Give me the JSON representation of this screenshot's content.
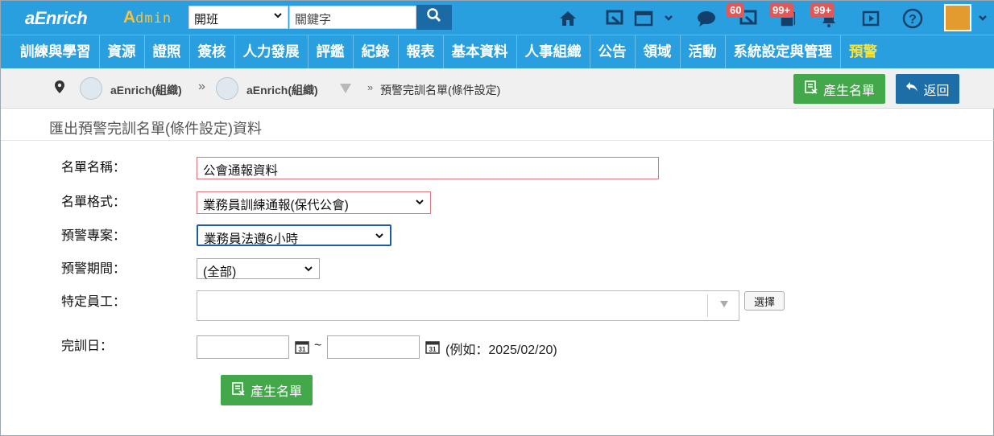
{
  "app": {
    "logo": "aEnrich",
    "admin_label_a": "A",
    "admin_label_rest": "dmin"
  },
  "topbar": {
    "course_select": "開班",
    "keyword_placeholder": "關鍵字",
    "badges": [
      "60",
      "99+",
      "99+"
    ]
  },
  "menu": {
    "items": [
      "訓練與學習",
      "資源",
      "證照",
      "簽核",
      "人力發展",
      "評鑑",
      "紀錄",
      "報表",
      "基本資料",
      "人事組織",
      "公告",
      "領域",
      "活動",
      "系統設定與管理",
      "預警"
    ],
    "active": "預警"
  },
  "breadcrumb": {
    "org1": "aEnrich(組織)",
    "org2": "aEnrich(組織)",
    "current": "預警完訓名單(條件設定)"
  },
  "actions": {
    "generate": "產生名單",
    "back": "返回"
  },
  "page": {
    "title": "匯出預警完訓名單(條件設定)資料"
  },
  "form": {
    "list_name_label": "名單名稱：",
    "list_name_value": "公會通報資料",
    "format_label": "名單格式：",
    "format_value": "業務員訓練通報(保代公會)",
    "project_label": "預警專案：",
    "project_value": "業務員法遵6小時",
    "period_label": "預警期間：",
    "period_value": "(全部)",
    "employee_label": "特定員工：",
    "choose_label": "選擇",
    "date_label": "完訓日：",
    "date_sep": "~",
    "date_hint": "(例如：2025/02/20)",
    "submit_label": "產生名單"
  },
  "colors": {
    "topbar": "#2a9fe0",
    "active_menu": "#f5e23a",
    "green": "#43a84a",
    "blue": "#1d6ea6"
  }
}
